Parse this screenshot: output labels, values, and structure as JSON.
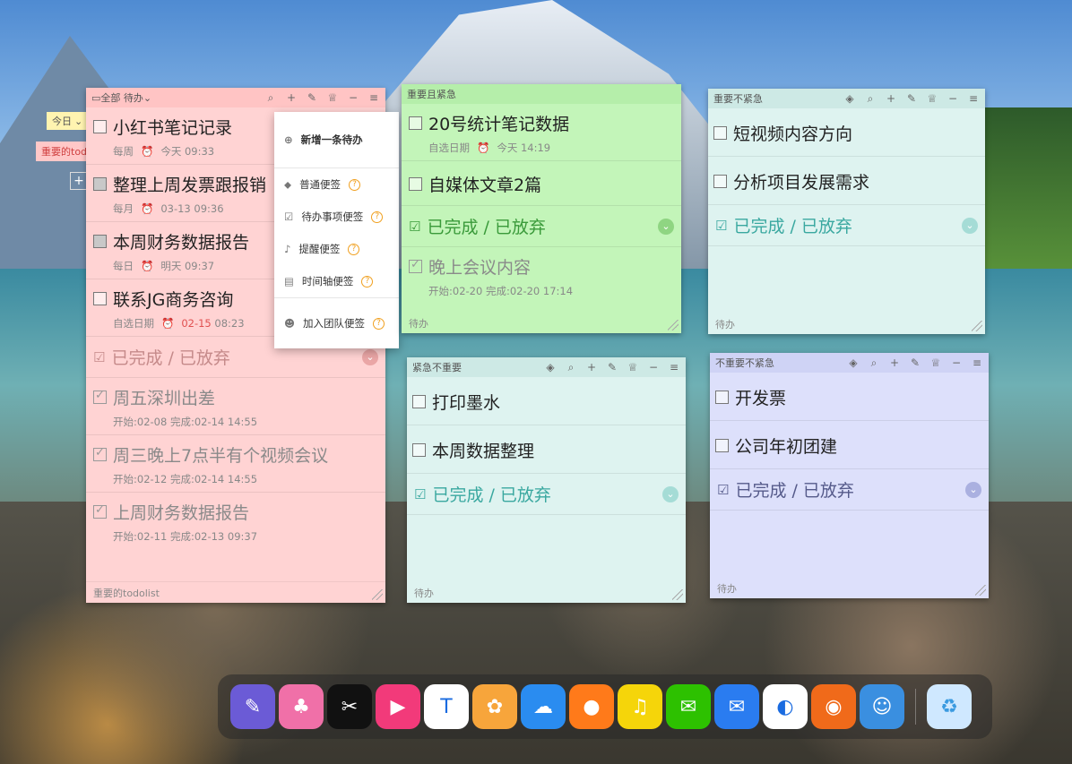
{
  "desktop": {
    "today_tag": "今日",
    "side_label": "重要的todolist"
  },
  "note_main": {
    "title_all": "全部",
    "title_filter": "待办",
    "items": [
      {
        "text": "小红书笔记记录",
        "repeat": "每周",
        "time": "今天 09:33",
        "time_red": ""
      },
      {
        "text": "整理上周发票跟报销",
        "repeat": "每月",
        "time": "03-13 09:36",
        "time_red": ""
      },
      {
        "text": "本周财务数据报告",
        "repeat": "每日",
        "time": "明天 09:37",
        "time_red": ""
      },
      {
        "text": "联系JG商务咨询",
        "repeat": "自选日期",
        "time": " 08:23",
        "time_red": "02-15"
      }
    ],
    "section": "已完成 / 已放弃",
    "done": [
      {
        "text": "周五深圳出差",
        "meta": "开始:02-08 完成:02-14 14:55"
      },
      {
        "text": "周三晚上7点半有个视频会议",
        "meta": "开始:02-12 完成:02-14 14:55"
      },
      {
        "text": "上周财务数据报告",
        "meta": "开始:02-11 完成:02-13 09:37"
      }
    ],
    "footer": "重要的todolist"
  },
  "menu": {
    "items": [
      {
        "label": "新增一条待办",
        "help": false
      },
      {
        "label": "普通便签",
        "help": true
      },
      {
        "label": "待办事项便签",
        "help": true
      },
      {
        "label": "提醒便签",
        "help": true
      },
      {
        "label": "时间轴便签",
        "help": true
      },
      {
        "label": "加入团队便签",
        "help": true
      }
    ]
  },
  "note_urgent_important": {
    "title": "重要且紧急",
    "items": [
      {
        "text": "20号统计笔记数据",
        "repeat": "自选日期",
        "time": "今天 14:19"
      },
      {
        "text": "自媒体文章2篇"
      }
    ],
    "section": "已完成 / 已放弃",
    "done": [
      {
        "text": "晚上会议内容",
        "meta": "开始:02-20 完成:02-20 17:14"
      }
    ],
    "footer": "待办"
  },
  "note_important_not_urgent": {
    "title": "重要不紧急",
    "items": [
      {
        "text": "短视频内容方向"
      },
      {
        "text": "分析项目发展需求"
      }
    ],
    "section": "已完成 / 已放弃",
    "footer": "待办"
  },
  "note_urgent_not_important": {
    "title": "紧急不重要",
    "items": [
      {
        "text": "打印墨水"
      },
      {
        "text": "本周数据整理"
      }
    ],
    "section": "已完成 / 已放弃",
    "footer": "待办"
  },
  "note_not_important_not_urgent": {
    "title": "不重要不紧急",
    "items": [
      {
        "text": "开发票"
      },
      {
        "text": "公司年初团建"
      }
    ],
    "section": "已完成 / 已放弃",
    "footer": "待办"
  },
  "dock": {
    "apps": [
      {
        "name": "notes-app",
        "glyph": "✎",
        "color": "#6b5bd6"
      },
      {
        "name": "character-app",
        "glyph": "♣",
        "color": "#f070a8"
      },
      {
        "name": "capcut-app",
        "glyph": "✂",
        "color": "#111111"
      },
      {
        "name": "video-app",
        "glyph": "▶",
        "color": "#f23a7a"
      },
      {
        "name": "tencent-docs-app",
        "glyph": "T",
        "color": "#ffffff"
      },
      {
        "name": "photos-app",
        "glyph": "✿",
        "color": "#f7a53b"
      },
      {
        "name": "cloud-app",
        "glyph": "☁",
        "color": "#2a8cf0"
      },
      {
        "name": "firefox-app",
        "glyph": "●",
        "color": "#ff7a1a"
      },
      {
        "name": "music-app",
        "glyph": "♫",
        "color": "#f5d50a"
      },
      {
        "name": "wechat-app",
        "glyph": "✉",
        "color": "#2dc100"
      },
      {
        "name": "chat-app",
        "glyph": "✉",
        "color": "#2a7cf0"
      },
      {
        "name": "qq-app",
        "glyph": "◐",
        "color": "#ffffff"
      },
      {
        "name": "game-app",
        "glyph": "◉",
        "color": "#f06a1a"
      },
      {
        "name": "finder-app",
        "glyph": "☺",
        "color": "#3a8fe0"
      }
    ],
    "trash": {
      "name": "recycle-bin",
      "glyph": "♻",
      "color": "#cfe8ff"
    }
  },
  "colors": {
    "pink": "#ffd3d3",
    "green": "#c3f5b9",
    "cyan": "#def3f0",
    "lavender": "#dde0fb"
  }
}
